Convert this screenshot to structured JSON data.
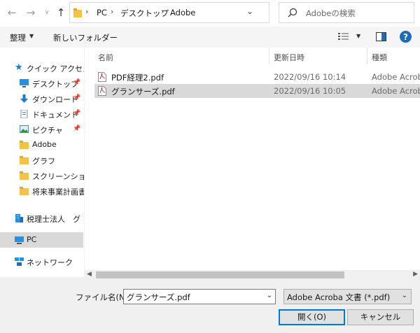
{
  "address": {
    "breadcrumb": [
      "PC",
      "デスクトップ",
      "Adobe"
    ],
    "search_placeholder": "Adobeの検索"
  },
  "toolbar": {
    "organize_label": "整理",
    "new_folder_label": "新しいフォルダー"
  },
  "nav": {
    "quick_access": "クイック アクセス",
    "items": [
      {
        "label": "デスクトップ",
        "pinned": true
      },
      {
        "label": "ダウンロード",
        "pinned": true
      },
      {
        "label": "ドキュメント",
        "pinned": true
      },
      {
        "label": "ピクチャ",
        "pinned": true
      },
      {
        "label": "Adobe",
        "pinned": false
      },
      {
        "label": "グラフ",
        "pinned": false
      },
      {
        "label": "スクリーンショット",
        "pinned": false
      },
      {
        "label": "将来事業計画書",
        "pinned": false
      }
    ],
    "onedrive": "税理士法人　グ",
    "pc": "PC",
    "network": "ネットワーク"
  },
  "columns": {
    "name": "名前",
    "date": "更新日時",
    "type": "種類"
  },
  "files": [
    {
      "name": "PDF経理2.pdf",
      "date": "2022/09/16 10:14",
      "type": "Adobe Acrobat Document",
      "selected": false
    },
    {
      "name": "グランサーズ.pdf",
      "date": "2022/09/16 10:05",
      "type": "Adobe Acrobat Document",
      "selected": true
    }
  ],
  "footer": {
    "filename_label": "ファイル名(N):",
    "filename_value": "グランサーズ.pdf",
    "filetype_value": "Adobe Acroba 文書 (*.pdf)",
    "open_label": "開く(O)",
    "cancel_label": "キャンセル"
  },
  "colors": {
    "accent": "#0078d7",
    "selection": "#d9d9d9",
    "folder": "#f3c24b",
    "pdf": "#d13438"
  }
}
